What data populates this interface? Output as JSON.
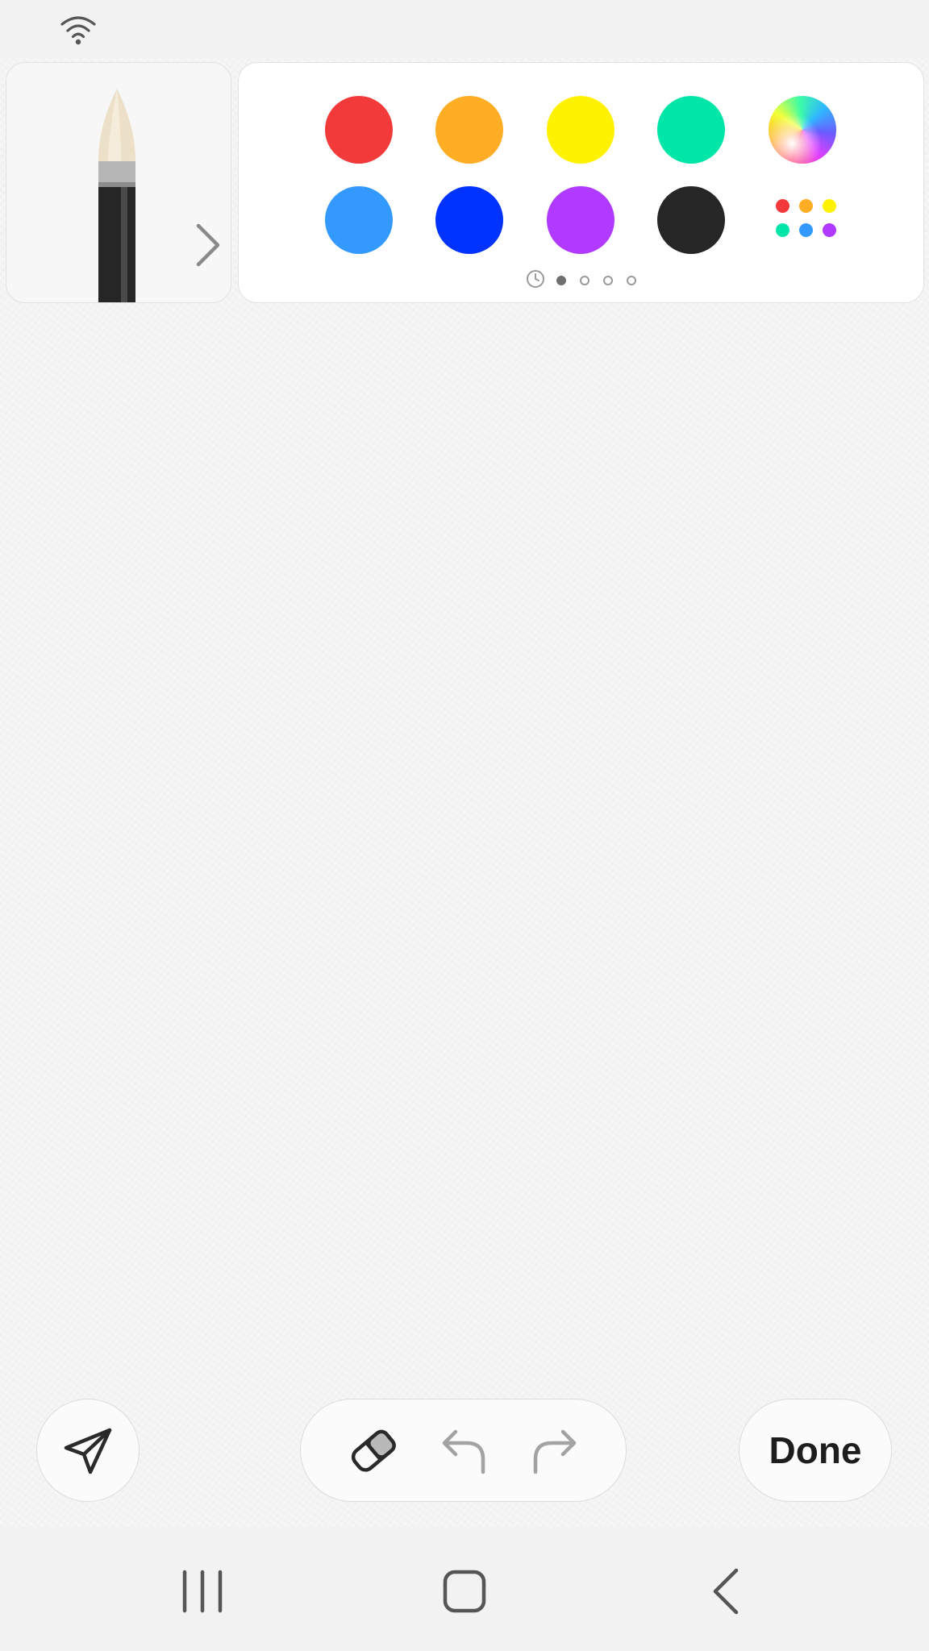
{
  "status_bar": {
    "icons": [
      "wifi-icon"
    ]
  },
  "brush": {
    "icon": "brush-icon",
    "expand_icon": "chevron-right-icon"
  },
  "palette": {
    "colors": [
      "#f23a3a",
      "#ffad25",
      "#fff200",
      "#00e6a8",
      "gradient",
      "#3399ff",
      "#0033ff",
      "#b03aff",
      "#262626"
    ],
    "more_icon": "palette-more-icon",
    "more_colors": [
      "#f23a3a",
      "#ffad25",
      "#fff200",
      "#00e6a8",
      "#3399ff",
      "#b03aff"
    ],
    "pages": 4,
    "current_page": 1,
    "recent_icon": "clock-icon"
  },
  "toolbar": {
    "send_icon": "send-icon",
    "eraser_icon": "eraser-icon",
    "undo_icon": "undo-icon",
    "redo_icon": "redo-icon",
    "done_label": "Done"
  },
  "nav_bar": {
    "icons": [
      "recent-apps-icon",
      "home-icon",
      "back-icon"
    ]
  }
}
